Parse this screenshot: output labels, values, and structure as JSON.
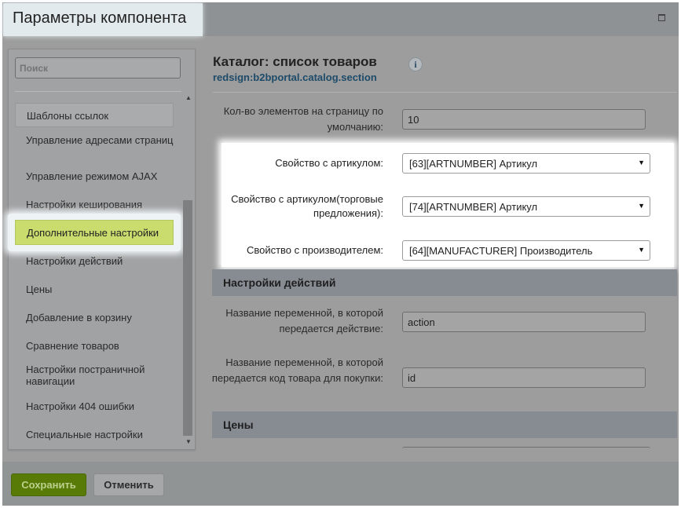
{
  "window": {
    "title": "Параметры компонента",
    "restore_icon": "window-restore-icon"
  },
  "sidebar": {
    "search_placeholder": "Поиск",
    "items": [
      {
        "label": "Шаблоны ссылок"
      },
      {
        "label": "Управление адресами страниц"
      },
      {
        "label": "Управление режимом AJAX"
      },
      {
        "label": "Настройки кеширования"
      },
      {
        "label": "Дополнительные настройки",
        "active": true
      },
      {
        "label": "Настройки действий"
      },
      {
        "label": "Цены"
      },
      {
        "label": "Добавление в корзину"
      },
      {
        "label": "Сравнение товаров"
      },
      {
        "label": "Настройки постраничной навигации"
      },
      {
        "label": "Настройки 404 ошибки"
      },
      {
        "label": "Специальные настройки"
      }
    ]
  },
  "main": {
    "title": "Каталог: список товаров",
    "subtitle": "redsign:b2bportal.catalog.section",
    "info_icon": "i",
    "fields": [
      {
        "label": "Кол-во элементов на страницу по умолчанию:",
        "value": "10"
      },
      {
        "label": "Свойство с артикулом:",
        "value": "[63][ARTNUMBER] Артикул"
      },
      {
        "label": "Свойство с артикулом(торговые предложения):",
        "value": "[74][ARTNUMBER] Артикул"
      },
      {
        "label": "Свойство с производителем:",
        "value": "[64][MANUFACTURER] Производитель"
      }
    ],
    "sections": [
      {
        "title": "Настройки действий",
        "fields": [
          {
            "label": "Название переменной, в которой передается действие:",
            "value": "action"
          },
          {
            "label": "Название переменной, в которой передается код товара для покупки:",
            "value": "id"
          }
        ]
      },
      {
        "title": "Цены"
      }
    ]
  },
  "footer": {
    "save_label": "Сохранить",
    "cancel_label": "Отменить"
  },
  "colors": {
    "highlight": "#c9dc6d",
    "save_button": "#587a06",
    "section_header": "#878c93"
  }
}
